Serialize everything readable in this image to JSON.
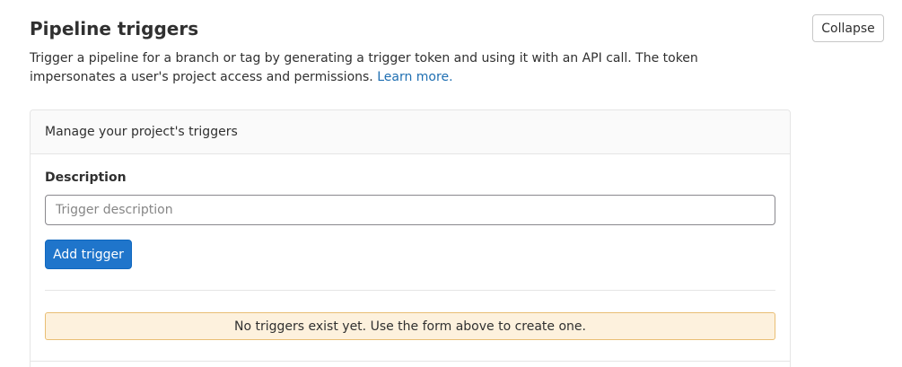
{
  "section": {
    "title": "Pipeline triggers",
    "collapse_label": "Collapse",
    "description": "Trigger a pipeline for a branch or tag by generating a trigger token and using it with an API call. The token impersonates a user's project access and permissions.",
    "learn_more": "Learn more."
  },
  "card": {
    "header": "Manage your project's triggers",
    "field_label": "Description",
    "input_placeholder": "Trigger description",
    "input_value": "",
    "add_button_label": "Add trigger",
    "empty_message": "No triggers exist yet. Use the form above to create one."
  },
  "colors": {
    "primary": "#1f75cb",
    "link": "#1f6fb2",
    "warning_bg": "#fdf1dd",
    "warning_border": "#e9be74"
  }
}
